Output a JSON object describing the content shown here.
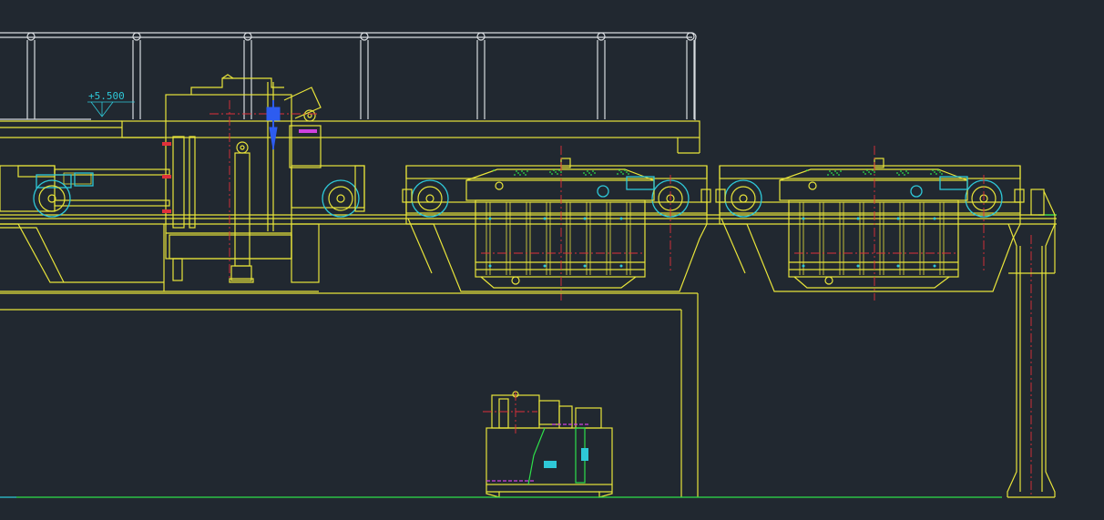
{
  "drawing": {
    "elevation_marker": {
      "label": "+5.500"
    },
    "colors": {
      "background": "#212830",
      "structure": "#e8e43a",
      "railing": "#d8dce0",
      "wheels": "#2ec8d8",
      "centerlines": "#e0303a",
      "ground": "#2ee04a",
      "hydraulic": "#2d5cf0",
      "piping": "#d040e0"
    },
    "components": [
      {
        "name": "guard-railing"
      },
      {
        "name": "upper-platform"
      },
      {
        "name": "lifting-mechanism"
      },
      {
        "name": "transfer-car-left"
      },
      {
        "name": "transfer-car-1"
      },
      {
        "name": "transfer-car-2"
      },
      {
        "name": "support-frame"
      },
      {
        "name": "support-column"
      },
      {
        "name": "hydraulic-power-unit"
      },
      {
        "name": "ground-line"
      }
    ]
  }
}
